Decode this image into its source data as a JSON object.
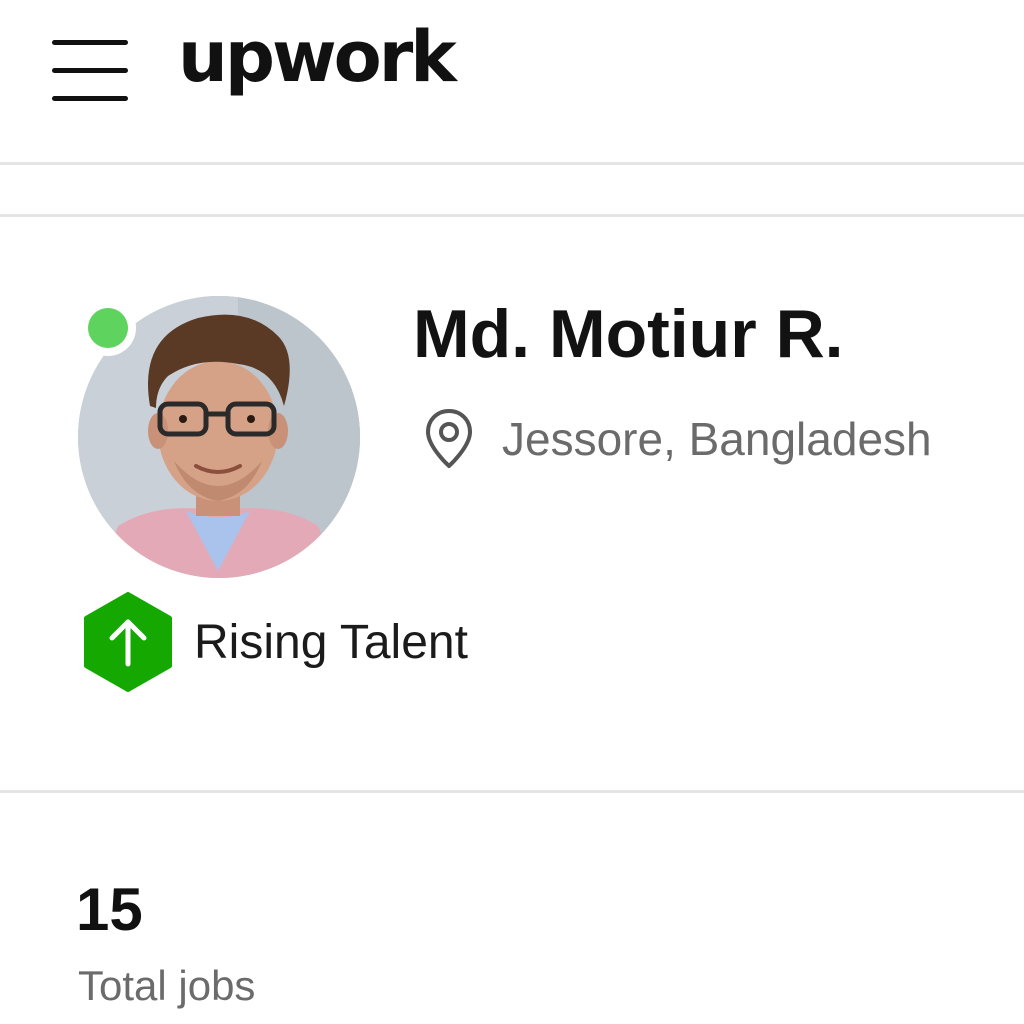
{
  "header": {
    "logo_text": "upwork",
    "menu_icon": "hamburger-menu-icon"
  },
  "profile": {
    "name": "Md. Motiur R.",
    "location": "Jessore, Bangladesh",
    "location_icon": "location-pin-icon",
    "online_status_color": "#5ed35e",
    "badge": {
      "label": "Rising Talent",
      "icon": "rising-talent-arrow-up-icon",
      "color": "#14a800"
    }
  },
  "stats": {
    "total_jobs": {
      "value": "15",
      "label": "Total jobs"
    }
  }
}
